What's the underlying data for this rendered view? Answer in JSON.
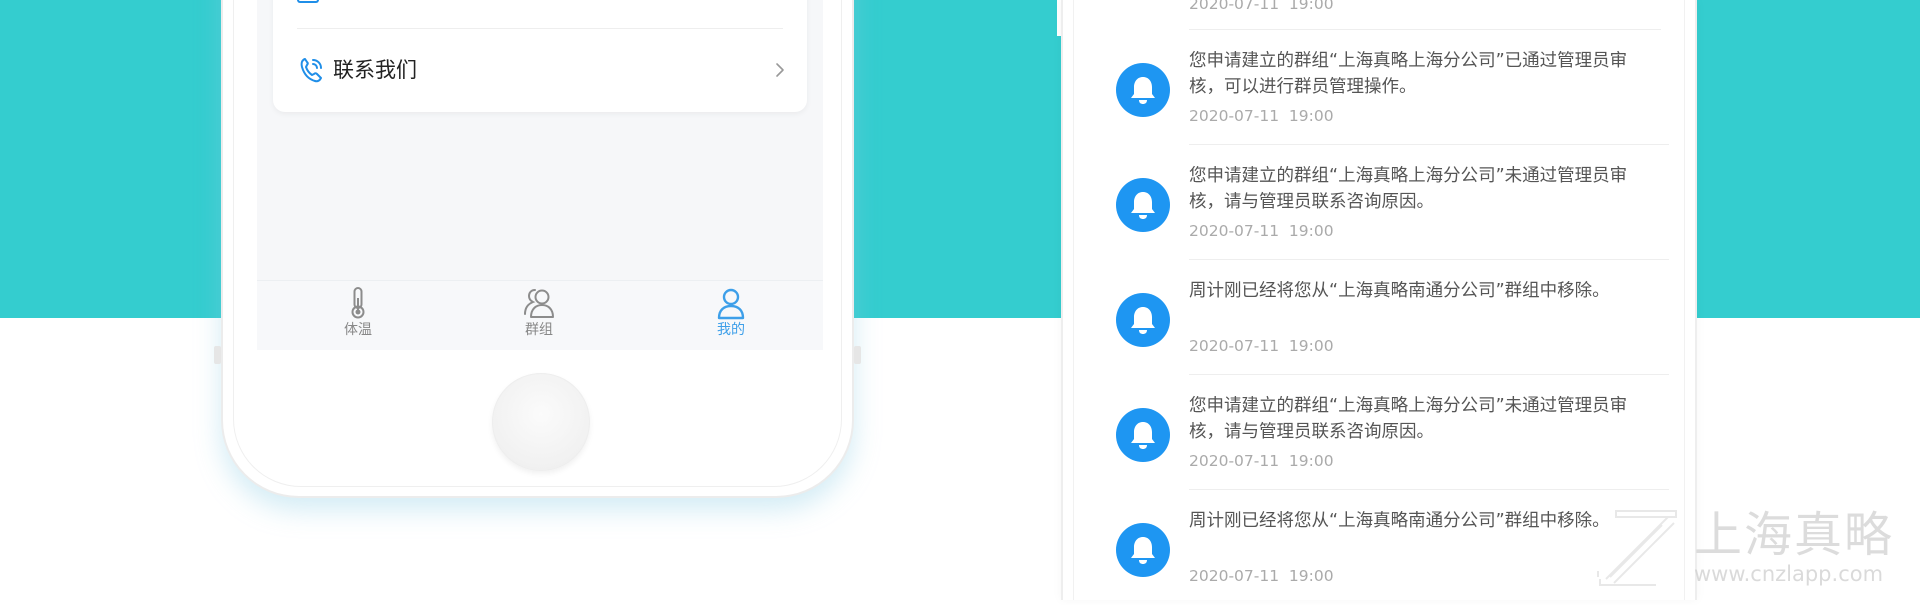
{
  "colors": {
    "background_teal": "#34cdcf",
    "accent_blue": "#1e96f2",
    "active_tab": "#3d9fe9",
    "inactive_tab": "#888888",
    "text_primary": "#222222",
    "text_secondary": "#555555",
    "text_time": "#aaaaaa"
  },
  "left_phone": {
    "profile_menu": {
      "items": [
        {
          "label": "联系我们",
          "icon": "phone-icon",
          "trailing_icon": "chevron-right-icon"
        }
      ]
    },
    "tabbar": {
      "active": "我的",
      "tabs": [
        {
          "label": "体温",
          "icon": "thermometer-icon"
        },
        {
          "label": "群组",
          "icon": "group-icon"
        },
        {
          "label": "我的",
          "icon": "person-icon"
        }
      ]
    },
    "home_button_icon": "home-button"
  },
  "right_phone": {
    "top_partial_time": "2020-07-11  19:00",
    "messages": [
      {
        "icon": "bell-icon",
        "text": "您申请建立的群组“上海真略上海分公司”已通过管理员审核，可以进行群员管理操作。",
        "time": "2020-07-11  19:00"
      },
      {
        "icon": "bell-icon",
        "text": "您申请建立的群组“上海真略上海分公司”未通过管理员审核，请与管理员联系咨询原因。",
        "time": "2020-07-11  19:00"
      },
      {
        "icon": "bell-icon",
        "text": "周计刚已经将您从“上海真略南通分公司”群组中移除。",
        "time": "2020-07-11  19:00"
      },
      {
        "icon": "bell-icon",
        "text": "您申请建立的群组“上海真略上海分公司”未通过管理员审核，请与管理员联系咨询原因。",
        "time": "2020-07-11  19:00"
      },
      {
        "icon": "bell-icon",
        "text": "周计刚已经将您从“上海真略南通分公司”群组中移除。",
        "time": "2020-07-11  19:00"
      }
    ]
  },
  "watermark": {
    "name": "上海真略",
    "url": "www.cnzlapp.com",
    "logo_icon": "zl-logo-icon"
  }
}
